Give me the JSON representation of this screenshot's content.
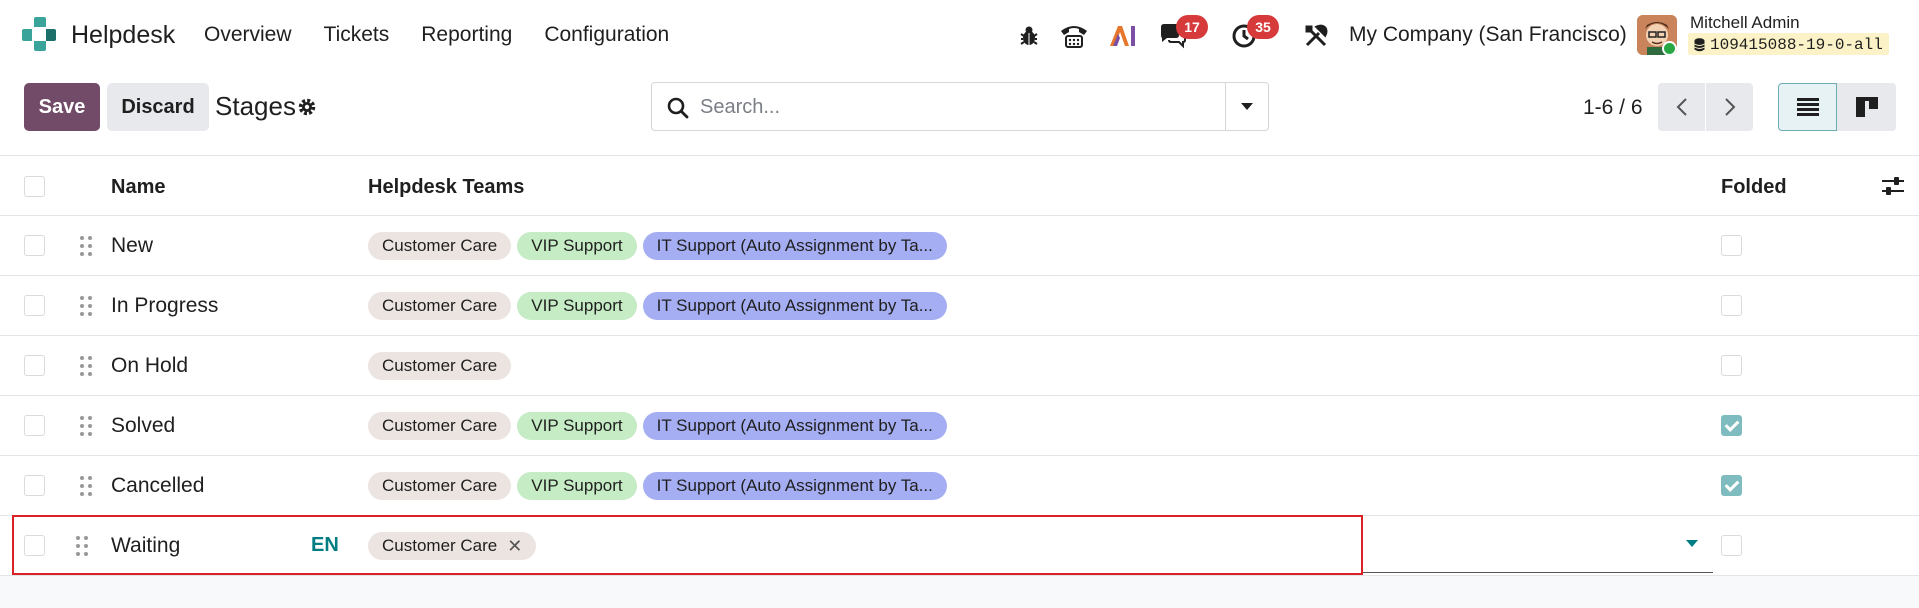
{
  "app": {
    "name": "Helpdesk"
  },
  "nav": {
    "items": [
      "Overview",
      "Tickets",
      "Reporting",
      "Configuration"
    ]
  },
  "tray": {
    "messages_count": "17",
    "activities_count": "35",
    "company": "My Company (San Francisco)",
    "user_name": "Mitchell Admin",
    "database": "109415088-19-0-all"
  },
  "control": {
    "save_label": "Save",
    "discard_label": "Discard",
    "title": "Stages",
    "search_placeholder": "Search...",
    "pager": "1-6 / 6"
  },
  "list": {
    "headers": {
      "name": "Name",
      "teams": "Helpdesk Teams",
      "folded": "Folded"
    },
    "rows": [
      {
        "name": "New",
        "teams": [
          "Customer Care",
          "VIP Support",
          "IT Support (Auto Assignment by Ta..."
        ],
        "folded": false
      },
      {
        "name": "In Progress",
        "teams": [
          "Customer Care",
          "VIP Support",
          "IT Support (Auto Assignment by Ta..."
        ],
        "folded": false
      },
      {
        "name": "On Hold",
        "teams": [
          "Customer Care"
        ],
        "folded": false
      },
      {
        "name": "Solved",
        "teams": [
          "Customer Care",
          "VIP Support",
          "IT Support (Auto Assignment by Ta..."
        ],
        "folded": true
      },
      {
        "name": "Cancelled",
        "teams": [
          "Customer Care",
          "VIP Support",
          "IT Support (Auto Assignment by Ta..."
        ],
        "folded": true
      }
    ],
    "editing_row": {
      "name": "Waiting",
      "lang": "EN",
      "teams": [
        "Customer Care"
      ],
      "folded": false,
      "remove_glyph": "✕"
    }
  },
  "colors": {
    "primary": "#714b67",
    "accent": "#017e84",
    "badge": "#d63a3a",
    "highlight_border": "#d92226"
  }
}
